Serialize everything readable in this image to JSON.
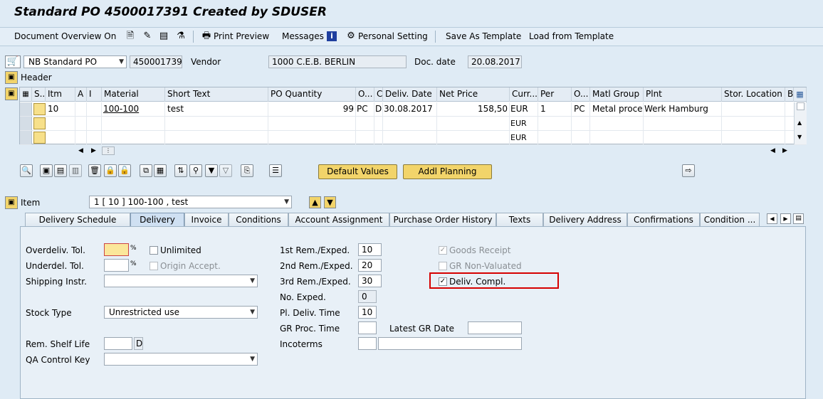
{
  "title": "Standard PO 4500017391 Created by SDUSER",
  "toolbar": {
    "document_overview": "Document Overview On",
    "print_preview": "Print Preview",
    "messages": "Messages",
    "personal_setting": "Personal Setting",
    "save_as_template": "Save As Template",
    "load_from_template": "Load from Template"
  },
  "header": {
    "doc_type": "NB Standard PO",
    "po_number": "4500017391",
    "vendor_label": "Vendor",
    "vendor_value": "1000 C.E.B. BERLIN",
    "doc_date_label": "Doc. date",
    "doc_date_value": "20.08.2017",
    "header_label": "Header"
  },
  "items_table": {
    "columns": [
      "S..",
      "Itm",
      "A",
      "I",
      "Material",
      "Short Text",
      "PO Quantity",
      "O...",
      "C",
      "Deliv. Date",
      "Net Price",
      "Curr...",
      "Per",
      "O...",
      "Matl Group",
      "Plnt",
      "Stor. Location",
      "B"
    ],
    "rows": [
      {
        "itm": "10",
        "a": "",
        "i": "",
        "material": "100-100",
        "short_text": "test",
        "po_quantity": "99",
        "unit": "PC",
        "c": "D",
        "deliv_date": "30.08.2017",
        "net_price": "158,50",
        "currency": "EUR",
        "per": "1",
        "order_unit": "PC",
        "matl_group": "Metal proce...",
        "plant": "Werk Hamburg",
        "stor_location": ""
      },
      {
        "currency": "EUR"
      },
      {
        "currency": "EUR"
      }
    ]
  },
  "buttons": {
    "default_values": "Default Values",
    "addl_planning": "Addl Planning"
  },
  "item_selector": {
    "label": "Item",
    "value": "1 [ 10 ] 100-100 , test"
  },
  "tabs": [
    "Delivery Schedule",
    "Delivery",
    "Invoice",
    "Conditions",
    "Account Assignment",
    "Purchase Order History",
    "Texts",
    "Delivery Address",
    "Confirmations",
    "Condition ..."
  ],
  "active_tab": "Delivery",
  "delivery": {
    "overdeliv_tol_label": "Overdeliv. Tol.",
    "overdeliv_tol_value": "",
    "underdel_tol_label": "Underdel. Tol.",
    "underdel_tol_value": "",
    "percent": "%",
    "unlimited_label": "Unlimited",
    "origin_accept_label": "Origin Accept.",
    "shipping_instr_label": "Shipping Instr.",
    "shipping_instr_value": "",
    "stock_type_label": "Stock Type",
    "stock_type_value": "Unrestricted use",
    "rem_shelf_life_label": "Rem. Shelf Life",
    "rem_shelf_life_unit": "D",
    "qa_control_key_label": "QA Control Key",
    "qa_control_key_value": "",
    "rem1_label": "1st Rem./Exped.",
    "rem1_value": "10",
    "rem2_label": "2nd Rem./Exped.",
    "rem2_value": "20",
    "rem3_label": "3rd Rem./Exped.",
    "rem3_value": "30",
    "no_exped_label": "No. Exped.",
    "no_exped_value": "0",
    "pl_deliv_time_label": "Pl. Deliv. Time",
    "pl_deliv_time_value": "10",
    "gr_proc_time_label": "GR Proc. Time",
    "gr_proc_time_value": "",
    "latest_gr_date_label": "Latest GR Date",
    "latest_gr_date_value": "",
    "incoterms_label": "Incoterms",
    "goods_receipt_label": "Goods Receipt",
    "gr_non_valuated_label": "GR Non-Valuated",
    "deliv_compl_label": "Deliv. Compl."
  },
  "colors": {
    "background": "#dfebf5",
    "highlight_box": "#d60000",
    "button_yellow": "#f2d46a"
  }
}
